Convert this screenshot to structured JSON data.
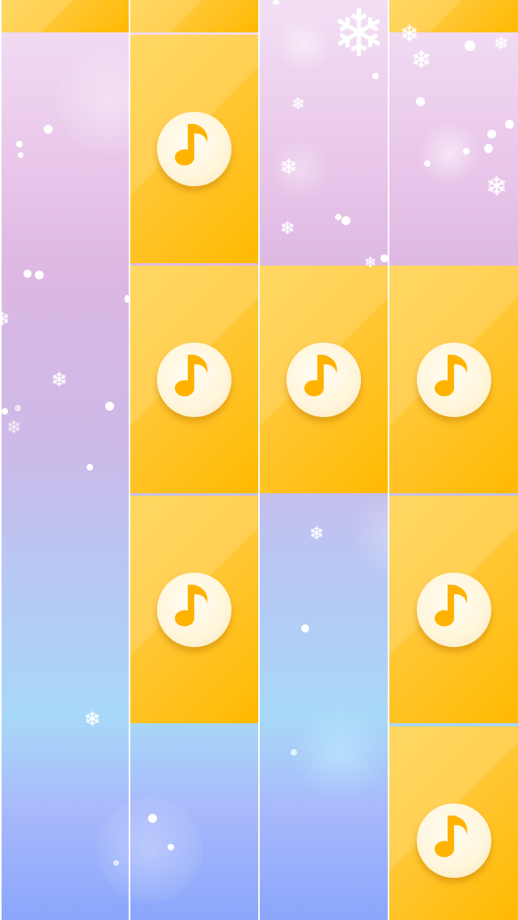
{
  "game": {
    "type": "piano-tiles",
    "lanes": 4,
    "tile_color": "#ffc12e",
    "tile_icon": "music-note-icon",
    "snowflake_glyph": "❄"
  },
  "rows": [
    {
      "row": "top-partial",
      "tiles": [
        true,
        true,
        false,
        true
      ]
    },
    {
      "row": 1,
      "tiles": [
        false,
        true,
        false,
        false
      ]
    },
    {
      "row": 2,
      "tiles": [
        false,
        true,
        true,
        true
      ]
    },
    {
      "row": 3,
      "tiles": [
        false,
        true,
        false,
        true
      ]
    },
    {
      "row": 4,
      "tiles": [
        false,
        false,
        false,
        true
      ]
    }
  ]
}
